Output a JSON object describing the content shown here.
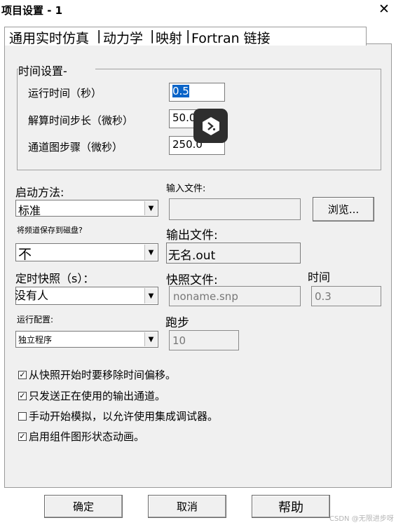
{
  "window": {
    "title": "项目设置 - 1",
    "close_glyph": "✕"
  },
  "tabs": [
    {
      "label": "通用实时仿真"
    },
    {
      "label": "动力学"
    },
    {
      "label": "映射"
    },
    {
      "label": "Fortran 链接"
    }
  ],
  "tab_separator": "|",
  "time_settings": {
    "legend": "时间设置-",
    "run_time": {
      "label": "运行时间（秒）",
      "value": "0.5"
    },
    "solve_step": {
      "label": "解算时间步长（微秒）",
      "value": "50.0"
    },
    "channel_step": {
      "label": "通道图步骤（微秒）",
      "value": "250.0"
    }
  },
  "start_method": {
    "label": "启动方法:",
    "value": "标准"
  },
  "input_file": {
    "label": "输入文件:",
    "value": ""
  },
  "browse_button": {
    "label": "浏览..."
  },
  "save_freq": {
    "label": "将频道保存到磁盘?",
    "value": "不"
  },
  "output_file": {
    "label": "输出文件:",
    "value": "无名.out"
  },
  "timed_snapshot": {
    "label": "定时快照（s）：",
    "value": "没有人"
  },
  "snapshot_file": {
    "label": "快照文件:",
    "value": "noname.snp"
  },
  "time_field": {
    "label": "时间",
    "value": "0.3"
  },
  "run_config": {
    "label": "运行配置:",
    "value": "独立程序"
  },
  "run_steps": {
    "label": "跑步",
    "value": "10"
  },
  "checkboxes": [
    {
      "label": "从快照开始时要移除时间偏移。",
      "checked": true
    },
    {
      "label": "只发送正在使用的输出通道。",
      "checked": true
    },
    {
      "label": "手动开始模拟，以允许使用集成调试器。",
      "checked": false
    },
    {
      "label": "启用组件图形状态动画。",
      "checked": true
    }
  ],
  "checkmark_glyph": "✓",
  "combo_arrow_glyph": "▼",
  "buttons": {
    "ok": "确定",
    "cancel": "取消",
    "help": "帮助"
  },
  "watermark": "CSDN @无限进步呀",
  "icons": {
    "close": "close-icon",
    "floating": "ai-assistant-icon",
    "dropdown": "chevron-down-icon"
  }
}
